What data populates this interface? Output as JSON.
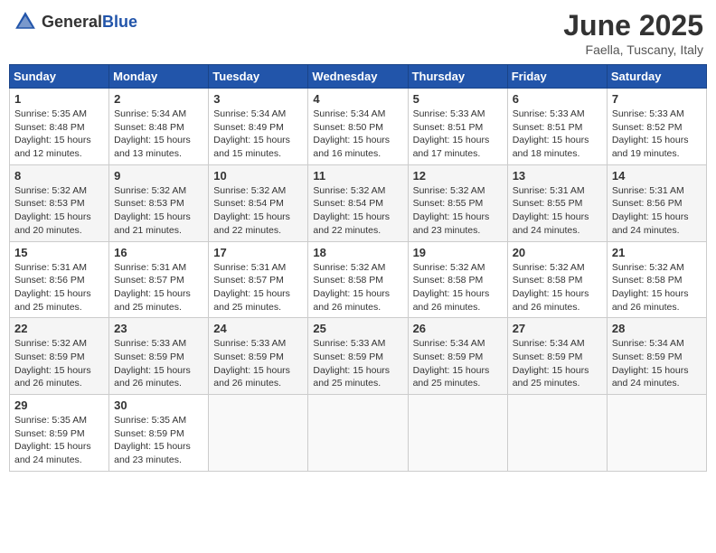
{
  "header": {
    "logo_general": "General",
    "logo_blue": "Blue",
    "title": "June 2025",
    "location": "Faella, Tuscany, Italy"
  },
  "calendar": {
    "days_of_week": [
      "Sunday",
      "Monday",
      "Tuesday",
      "Wednesday",
      "Thursday",
      "Friday",
      "Saturday"
    ],
    "weeks": [
      [
        {
          "day": "",
          "info": ""
        },
        {
          "day": "2",
          "info": "Sunrise: 5:34 AM\nSunset: 8:48 PM\nDaylight: 15 hours\nand 13 minutes."
        },
        {
          "day": "3",
          "info": "Sunrise: 5:34 AM\nSunset: 8:49 PM\nDaylight: 15 hours\nand 15 minutes."
        },
        {
          "day": "4",
          "info": "Sunrise: 5:34 AM\nSunset: 8:50 PM\nDaylight: 15 hours\nand 16 minutes."
        },
        {
          "day": "5",
          "info": "Sunrise: 5:33 AM\nSunset: 8:51 PM\nDaylight: 15 hours\nand 17 minutes."
        },
        {
          "day": "6",
          "info": "Sunrise: 5:33 AM\nSunset: 8:51 PM\nDaylight: 15 hours\nand 18 minutes."
        },
        {
          "day": "7",
          "info": "Sunrise: 5:33 AM\nSunset: 8:52 PM\nDaylight: 15 hours\nand 19 minutes."
        }
      ],
      [
        {
          "day": "1",
          "info": "Sunrise: 5:35 AM\nSunset: 8:48 PM\nDaylight: 15 hours\nand 12 minutes."
        },
        {
          "day": "",
          "info": ""
        },
        {
          "day": "",
          "info": ""
        },
        {
          "day": "",
          "info": ""
        },
        {
          "day": "",
          "info": ""
        },
        {
          "day": "",
          "info": ""
        },
        {
          "day": "",
          "info": ""
        }
      ],
      [
        {
          "day": "8",
          "info": "Sunrise: 5:32 AM\nSunset: 8:53 PM\nDaylight: 15 hours\nand 20 minutes."
        },
        {
          "day": "9",
          "info": "Sunrise: 5:32 AM\nSunset: 8:53 PM\nDaylight: 15 hours\nand 21 minutes."
        },
        {
          "day": "10",
          "info": "Sunrise: 5:32 AM\nSunset: 8:54 PM\nDaylight: 15 hours\nand 22 minutes."
        },
        {
          "day": "11",
          "info": "Sunrise: 5:32 AM\nSunset: 8:54 PM\nDaylight: 15 hours\nand 22 minutes."
        },
        {
          "day": "12",
          "info": "Sunrise: 5:32 AM\nSunset: 8:55 PM\nDaylight: 15 hours\nand 23 minutes."
        },
        {
          "day": "13",
          "info": "Sunrise: 5:31 AM\nSunset: 8:55 PM\nDaylight: 15 hours\nand 24 minutes."
        },
        {
          "day": "14",
          "info": "Sunrise: 5:31 AM\nSunset: 8:56 PM\nDaylight: 15 hours\nand 24 minutes."
        }
      ],
      [
        {
          "day": "15",
          "info": "Sunrise: 5:31 AM\nSunset: 8:56 PM\nDaylight: 15 hours\nand 25 minutes."
        },
        {
          "day": "16",
          "info": "Sunrise: 5:31 AM\nSunset: 8:57 PM\nDaylight: 15 hours\nand 25 minutes."
        },
        {
          "day": "17",
          "info": "Sunrise: 5:31 AM\nSunset: 8:57 PM\nDaylight: 15 hours\nand 25 minutes."
        },
        {
          "day": "18",
          "info": "Sunrise: 5:32 AM\nSunset: 8:58 PM\nDaylight: 15 hours\nand 26 minutes."
        },
        {
          "day": "19",
          "info": "Sunrise: 5:32 AM\nSunset: 8:58 PM\nDaylight: 15 hours\nand 26 minutes."
        },
        {
          "day": "20",
          "info": "Sunrise: 5:32 AM\nSunset: 8:58 PM\nDaylight: 15 hours\nand 26 minutes."
        },
        {
          "day": "21",
          "info": "Sunrise: 5:32 AM\nSunset: 8:58 PM\nDaylight: 15 hours\nand 26 minutes."
        }
      ],
      [
        {
          "day": "22",
          "info": "Sunrise: 5:32 AM\nSunset: 8:59 PM\nDaylight: 15 hours\nand 26 minutes."
        },
        {
          "day": "23",
          "info": "Sunrise: 5:33 AM\nSunset: 8:59 PM\nDaylight: 15 hours\nand 26 minutes."
        },
        {
          "day": "24",
          "info": "Sunrise: 5:33 AM\nSunset: 8:59 PM\nDaylight: 15 hours\nand 26 minutes."
        },
        {
          "day": "25",
          "info": "Sunrise: 5:33 AM\nSunset: 8:59 PM\nDaylight: 15 hours\nand 25 minutes."
        },
        {
          "day": "26",
          "info": "Sunrise: 5:34 AM\nSunset: 8:59 PM\nDaylight: 15 hours\nand 25 minutes."
        },
        {
          "day": "27",
          "info": "Sunrise: 5:34 AM\nSunset: 8:59 PM\nDaylight: 15 hours\nand 25 minutes."
        },
        {
          "day": "28",
          "info": "Sunrise: 5:34 AM\nSunset: 8:59 PM\nDaylight: 15 hours\nand 24 minutes."
        }
      ],
      [
        {
          "day": "29",
          "info": "Sunrise: 5:35 AM\nSunset: 8:59 PM\nDaylight: 15 hours\nand 24 minutes."
        },
        {
          "day": "30",
          "info": "Sunrise: 5:35 AM\nSunset: 8:59 PM\nDaylight: 15 hours\nand 23 minutes."
        },
        {
          "day": "",
          "info": ""
        },
        {
          "day": "",
          "info": ""
        },
        {
          "day": "",
          "info": ""
        },
        {
          "day": "",
          "info": ""
        },
        {
          "day": "",
          "info": ""
        }
      ]
    ]
  }
}
